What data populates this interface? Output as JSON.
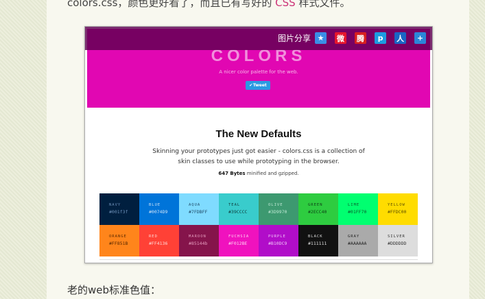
{
  "article": {
    "top_text_before": "colors.css，颜色更好看了，而且已有写好的 ",
    "top_text_link": "CSS",
    "top_text_after": " 样式文件。",
    "bottom_text": "老的web标准色值："
  },
  "share_bar": {
    "label": "图片分享",
    "icons": [
      {
        "name": "qzone-icon",
        "glyph": "★",
        "bg": "#3a8ee6"
      },
      {
        "name": "weibo-icon",
        "glyph": "微",
        "bg": "#e6162d"
      },
      {
        "name": "tencent-weibo-icon",
        "glyph": "腾",
        "bg": "#d72020"
      },
      {
        "name": "pengyou-icon",
        "glyph": "p",
        "bg": "#1d9be0"
      },
      {
        "name": "renren-icon",
        "glyph": "人",
        "bg": "#1a66c4"
      },
      {
        "name": "more-share-icon",
        "glyph": "+",
        "bg": "#2b86d8"
      }
    ]
  },
  "preview": {
    "hero_title": "COLORS",
    "hero_subtitle": "A nicer color palette for the web.",
    "tweet_label": "Tweet",
    "heading": "The New Defaults",
    "description_line1": "Skinning your prototypes just got easier - colors.css is a collection of",
    "description_line2": "skin classes to use while prototyping in the browser.",
    "size_bold": "647 Bytes",
    "size_rest": " minified and gzipped.",
    "colors": [
      {
        "name": "NAVY",
        "hex": "#001f3f",
        "bg": "#001f3f",
        "fg": "#6d8fb8"
      },
      {
        "name": "BLUE",
        "hex": "#0074D9",
        "bg": "#0074d9",
        "fg": "#cfe3f8"
      },
      {
        "name": "AQUA",
        "hex": "#7FDBFF",
        "bg": "#7fdbff",
        "fg": "#1f4a66"
      },
      {
        "name": "TEAL",
        "hex": "#39CCCC",
        "bg": "#39cccc",
        "fg": "#0f3d3d"
      },
      {
        "name": "OLIVE",
        "hex": "#3D9970",
        "bg": "#3d9970",
        "fg": "#bfe8d4"
      },
      {
        "name": "GREEN",
        "hex": "#2ECC40",
        "bg": "#2ecc40",
        "fg": "#0e4216"
      },
      {
        "name": "LIME",
        "hex": "#01FF70",
        "bg": "#01ff70",
        "fg": "#0a5a2c"
      },
      {
        "name": "YELLOW",
        "hex": "#FFDC00",
        "bg": "#ffdc00",
        "fg": "#5e5000"
      },
      {
        "name": "ORANGE",
        "hex": "#FF851B",
        "bg": "#ff851b",
        "fg": "#5a2a00"
      },
      {
        "name": "RED",
        "hex": "#FF4136",
        "bg": "#ff4136",
        "fg": "#ffd7d4"
      },
      {
        "name": "MAROON",
        "hex": "#85144b",
        "bg": "#85144b",
        "fg": "#e49bbd"
      },
      {
        "name": "FUCHSIA",
        "hex": "#F012BE",
        "bg": "#f012be",
        "fg": "#ffd0f1"
      },
      {
        "name": "PURPLE",
        "hex": "#B10DC9",
        "bg": "#b10dc9",
        "fg": "#efc4f7"
      },
      {
        "name": "BLACK",
        "hex": "#111111",
        "bg": "#111111",
        "fg": "#dddddd"
      },
      {
        "name": "GRAY",
        "hex": "#AAAAAA",
        "bg": "#aaaaaa",
        "fg": "#222222"
      },
      {
        "name": "SILVER",
        "hex": "#DDDDDD",
        "bg": "#dddddd",
        "fg": "#333333"
      }
    ]
  }
}
